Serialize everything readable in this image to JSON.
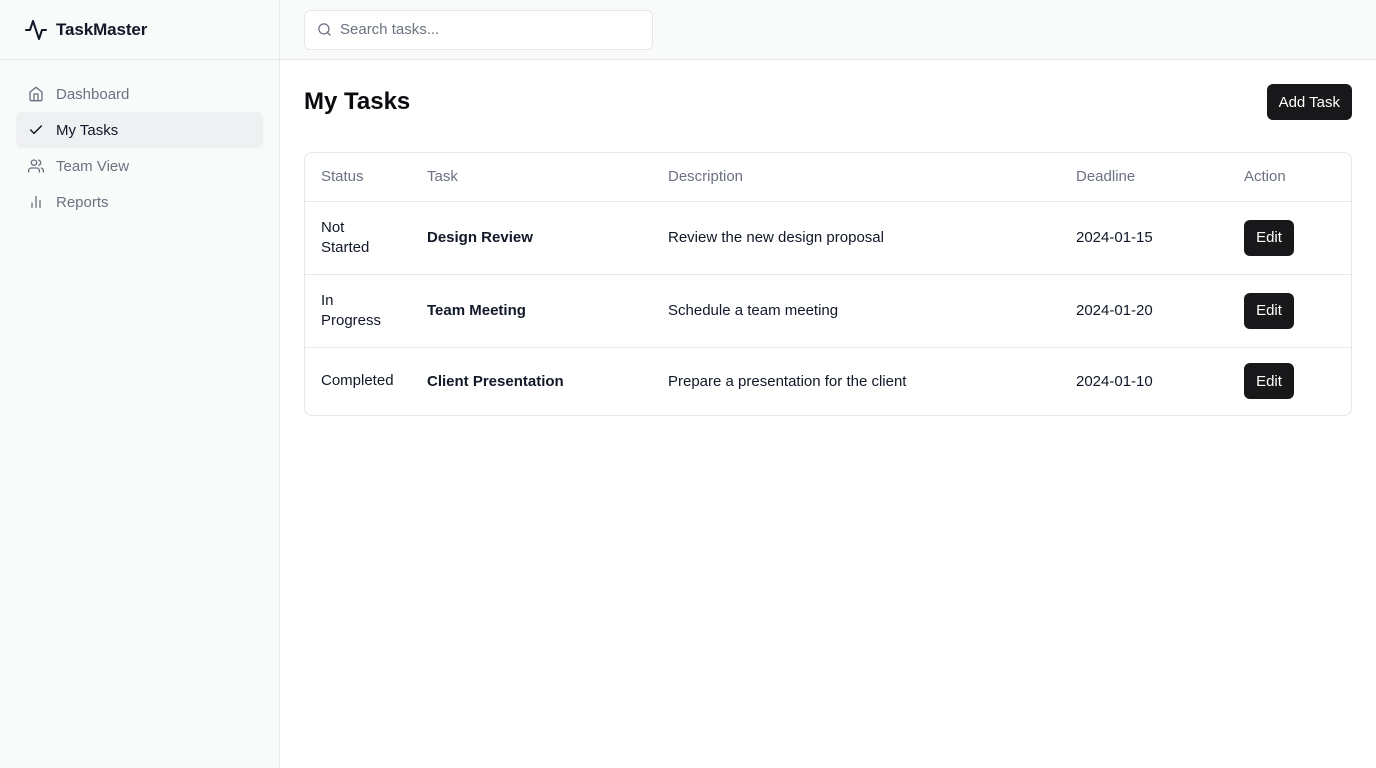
{
  "app": {
    "name": "TaskMaster",
    "logo_icon": "activity-pulse-icon"
  },
  "sidebar": {
    "items": [
      {
        "label": "Dashboard",
        "icon": "home-icon",
        "active": false
      },
      {
        "label": "My Tasks",
        "icon": "check-icon",
        "active": true
      },
      {
        "label": "Team View",
        "icon": "users-icon",
        "active": false
      },
      {
        "label": "Reports",
        "icon": "bar-chart-icon",
        "active": false
      }
    ]
  },
  "search": {
    "placeholder": "Search tasks...",
    "value": ""
  },
  "main": {
    "title": "My Tasks",
    "add_button_label": "Add Task"
  },
  "table": {
    "headers": {
      "status": "Status",
      "task": "Task",
      "description": "Description",
      "deadline": "Deadline",
      "action": "Action"
    },
    "rows": [
      {
        "status": "Not Started",
        "task": "Design Review",
        "description": "Review the new design proposal",
        "deadline": "2024-01-15",
        "action_label": "Edit"
      },
      {
        "status": "In Progress",
        "task": "Team Meeting",
        "description": "Schedule a team meeting",
        "deadline": "2024-01-20",
        "action_label": "Edit"
      },
      {
        "status": "Completed",
        "task": "Client Presentation",
        "description": "Prepare a presentation for the client",
        "deadline": "2024-01-10",
        "action_label": "Edit"
      }
    ]
  },
  "colors": {
    "primary_button": "#18181b",
    "sidebar_bg": "#f9fafa",
    "active_nav_bg": "#eff0f2",
    "muted_text": "#6b7280",
    "border": "#e5e7eb"
  }
}
